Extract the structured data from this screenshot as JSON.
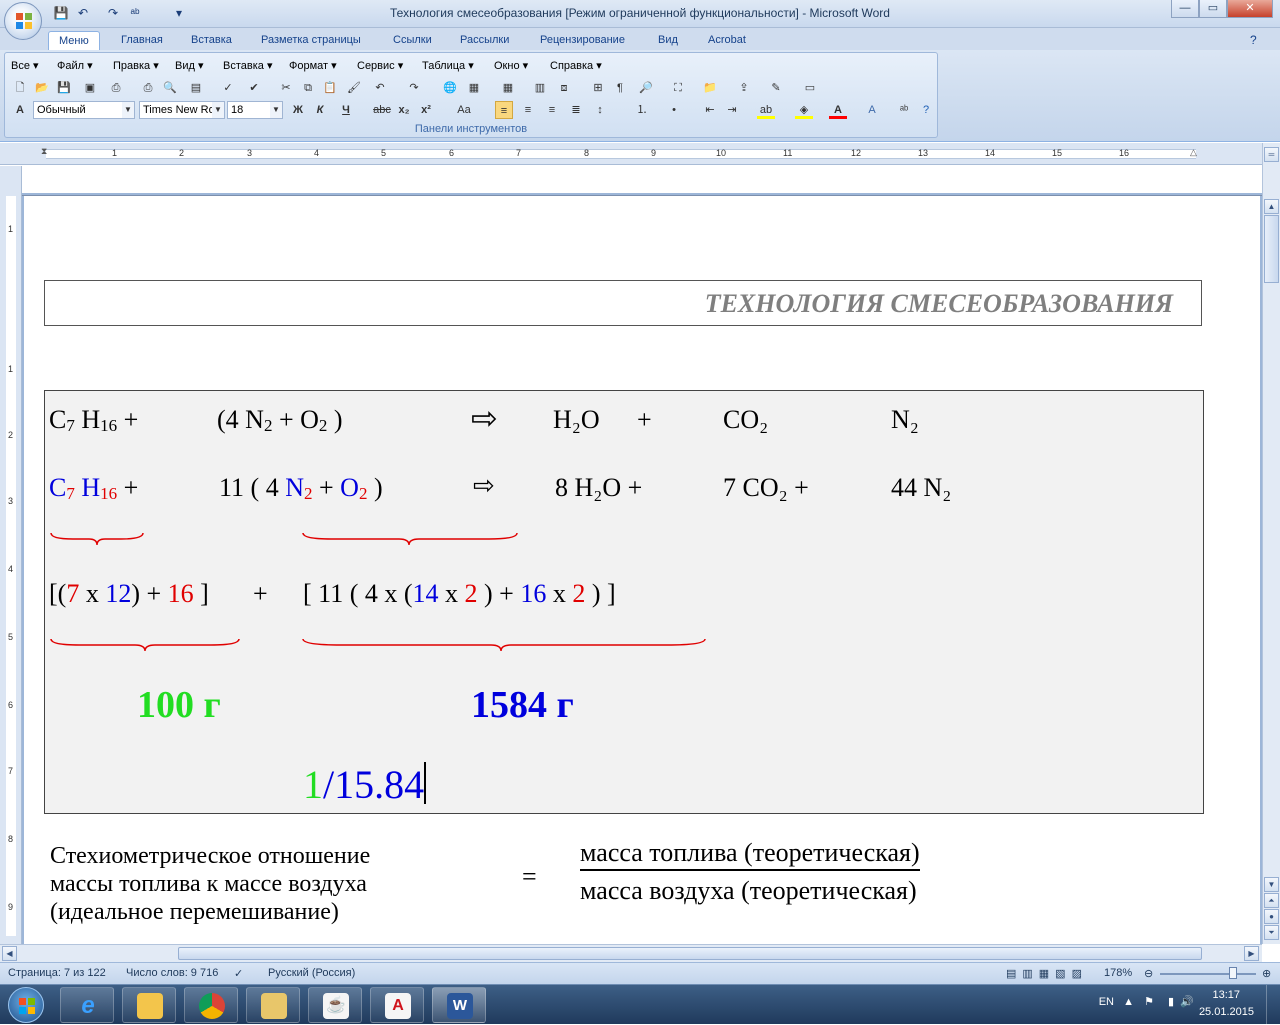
{
  "window": {
    "title": "Технология смесеобразования [Режим ограниченной функциональности] - Microsoft Word",
    "min_glyph": "—",
    "max_glyph": "▭",
    "close_glyph": "✕"
  },
  "tabs": [
    "Меню",
    "Главная",
    "Вставка",
    "Разметка страницы",
    "Ссылки",
    "Рассылки",
    "Рецензирование",
    "Вид",
    "Acrobat"
  ],
  "menu_bar": [
    "Все",
    "Файл",
    "Правка",
    "Вид",
    "Вставка",
    "Формат",
    "Сервис",
    "Таблица",
    "Окно",
    "Справка"
  ],
  "toolbar": {
    "style_value": "Обычный",
    "font_value": "Times New Ro",
    "size_value": "18",
    "bold": "Ж",
    "italic": "К",
    "underline": "Ч",
    "strike": "abc",
    "subscript": "x₂",
    "superscript": "x²",
    "case": "Aa",
    "group_label": "Панели инструментов"
  },
  "ruler": {
    "h_numbers": [
      "1",
      "2",
      "3",
      "4",
      "5",
      "6",
      "7",
      "8",
      "9",
      "10",
      "11",
      "12",
      "13",
      "14",
      "15",
      "16"
    ],
    "v_numbers": [
      "1",
      "1",
      "2",
      "3",
      "4",
      "5",
      "6",
      "7",
      "8",
      "9"
    ]
  },
  "document": {
    "header": "ТЕХНОЛОГИЯ СМЕСЕОБРАЗОВАНИЯ",
    "row1": {
      "fuel_c": "C",
      "fuel_c_sub": "7",
      "fuel_h": " H",
      "fuel_h_sub": "16",
      "plus": " +",
      "air": "(4 N",
      "air_sub": "2",
      "air2": "  + O",
      "air2_sub": "2",
      "air_close": " )",
      "arrow": "⇨",
      "h2o": "H₂O",
      "plus2": "+",
      "co2": "CO₂",
      "n2": "N₂"
    },
    "row2": {
      "fuel_c": "C",
      "fuel_c_sub": "7",
      "fuel_h": " H",
      "fuel_h_sub": "16",
      "plus": " +",
      "coef": "11 ( 4 ",
      "n": "N",
      "n_sub": "2",
      "op": " + ",
      "o": "O",
      "o_sub": "2",
      "close": " )",
      "arrow": "⇨",
      "h2o": "8 H₂O +",
      "co2": "7 CO₂ +",
      "n2": "44 N₂"
    },
    "row3": {
      "a1": "[(",
      "a2": "7",
      "a3": " x ",
      "a4": "12",
      "a5": ") + ",
      "a6": "16",
      "a7": " ]",
      "plus": "+",
      "b1": "[ 11 ( 4 x (",
      "b2": "14",
      "b3": " x ",
      "b4": "2",
      "b5": " ) + ",
      "b6": "16",
      "b7": " x ",
      "b8": "2",
      "b9": " ) ]"
    },
    "fuel_mass": "100 г",
    "air_mass": "1584 г",
    "ratio_num": "1",
    "ratio_rest": "/15.84",
    "stoich_line1": "Стехиометрическое отношение",
    "stoich_line2": "массы топлива к массе воздуха",
    "stoich_line3": "(идеальное перемешивание)",
    "equals": "=",
    "numerator": "масса топлива (теоретическая)",
    "denominator": "масса воздуха (теоретическая)"
  },
  "status": {
    "page": "Страница: 7 из 122",
    "words": "Число слов: 9 716",
    "language": "Русский (Россия)",
    "zoom": "178%",
    "zoom_level": 0.78
  },
  "tray": {
    "lang": "EN",
    "time": "13:17",
    "date": "25.01.2015"
  },
  "colors": {
    "blue": "#0000dd",
    "red": "#e00000",
    "green": "#22dd22"
  }
}
